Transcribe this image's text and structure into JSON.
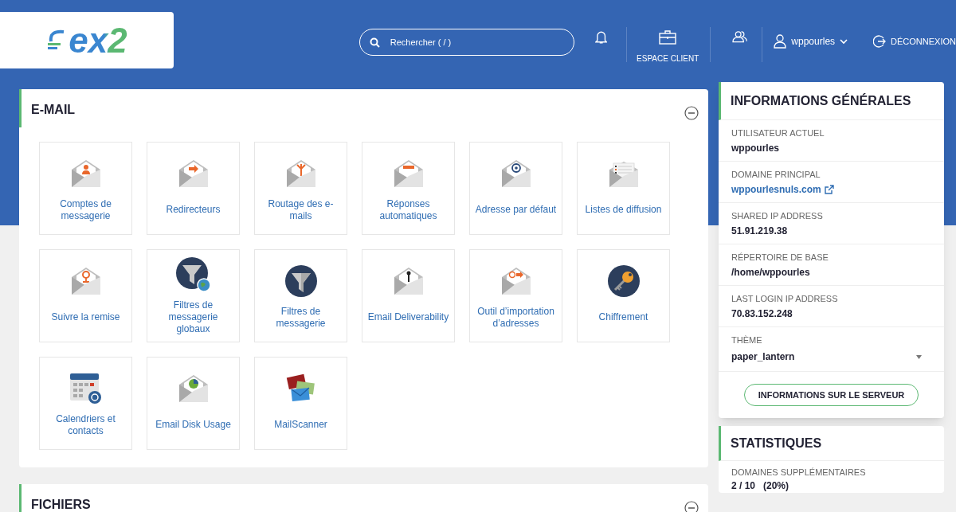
{
  "header": {
    "logo": "ex2",
    "search": {
      "placeholder": "Rechercher ( / )"
    },
    "client_area": "ESPACE CLIENT",
    "user": "wppourles",
    "logout": "DÉCONNEXION"
  },
  "sections": [
    {
      "title": "E-MAIL",
      "expanded": true,
      "tiles": [
        {
          "label": "Comptes de messagerie"
        },
        {
          "label": "Redirecteurs"
        },
        {
          "label": "Routage des e-mails"
        },
        {
          "label": "Réponses automatiques"
        },
        {
          "label": "Adresse par défaut"
        },
        {
          "label": "Listes de diffusion"
        },
        {
          "label": "Suivre la remise"
        },
        {
          "label": "Filtres de messagerie globaux"
        },
        {
          "label": "Filtres de messagerie"
        },
        {
          "label": "Email Deliverability"
        },
        {
          "label": "Outil d’importation d’adresses"
        },
        {
          "label": "Chiffrement"
        },
        {
          "label": "Calendriers et contacts"
        },
        {
          "label": "Email Disk Usage"
        },
        {
          "label": "MailScanner"
        }
      ]
    },
    {
      "title": "FICHIERS",
      "expanded": true
    }
  ],
  "info": {
    "title": "INFORMATIONS GÉNÉRALES",
    "rows": [
      {
        "kind": "text",
        "label": "UTILISATEUR ACTUEL",
        "value": "wppourles"
      },
      {
        "kind": "link",
        "label": "DOMAINE PRINCIPAL",
        "value": "wppourlesnuls.com"
      },
      {
        "kind": "text",
        "label": "SHARED IP ADDRESS",
        "value": "51.91.219.38"
      },
      {
        "kind": "text",
        "label": "RÉPERTOIRE DE BASE",
        "value": "/home/wppourles"
      },
      {
        "kind": "text",
        "label": "LAST LOGIN IP ADDRESS",
        "value": "70.83.152.248"
      },
      {
        "kind": "select",
        "label": "THÈME",
        "value": "paper_lantern"
      }
    ],
    "button": "INFORMATIONS SUR LE SERVEUR"
  },
  "stats": {
    "title": "STATISTIQUES",
    "rows": [
      {
        "label": "DOMAINES SUPPLÉMENTAIRES",
        "value": "2 / 10   (20%)"
      }
    ]
  }
}
